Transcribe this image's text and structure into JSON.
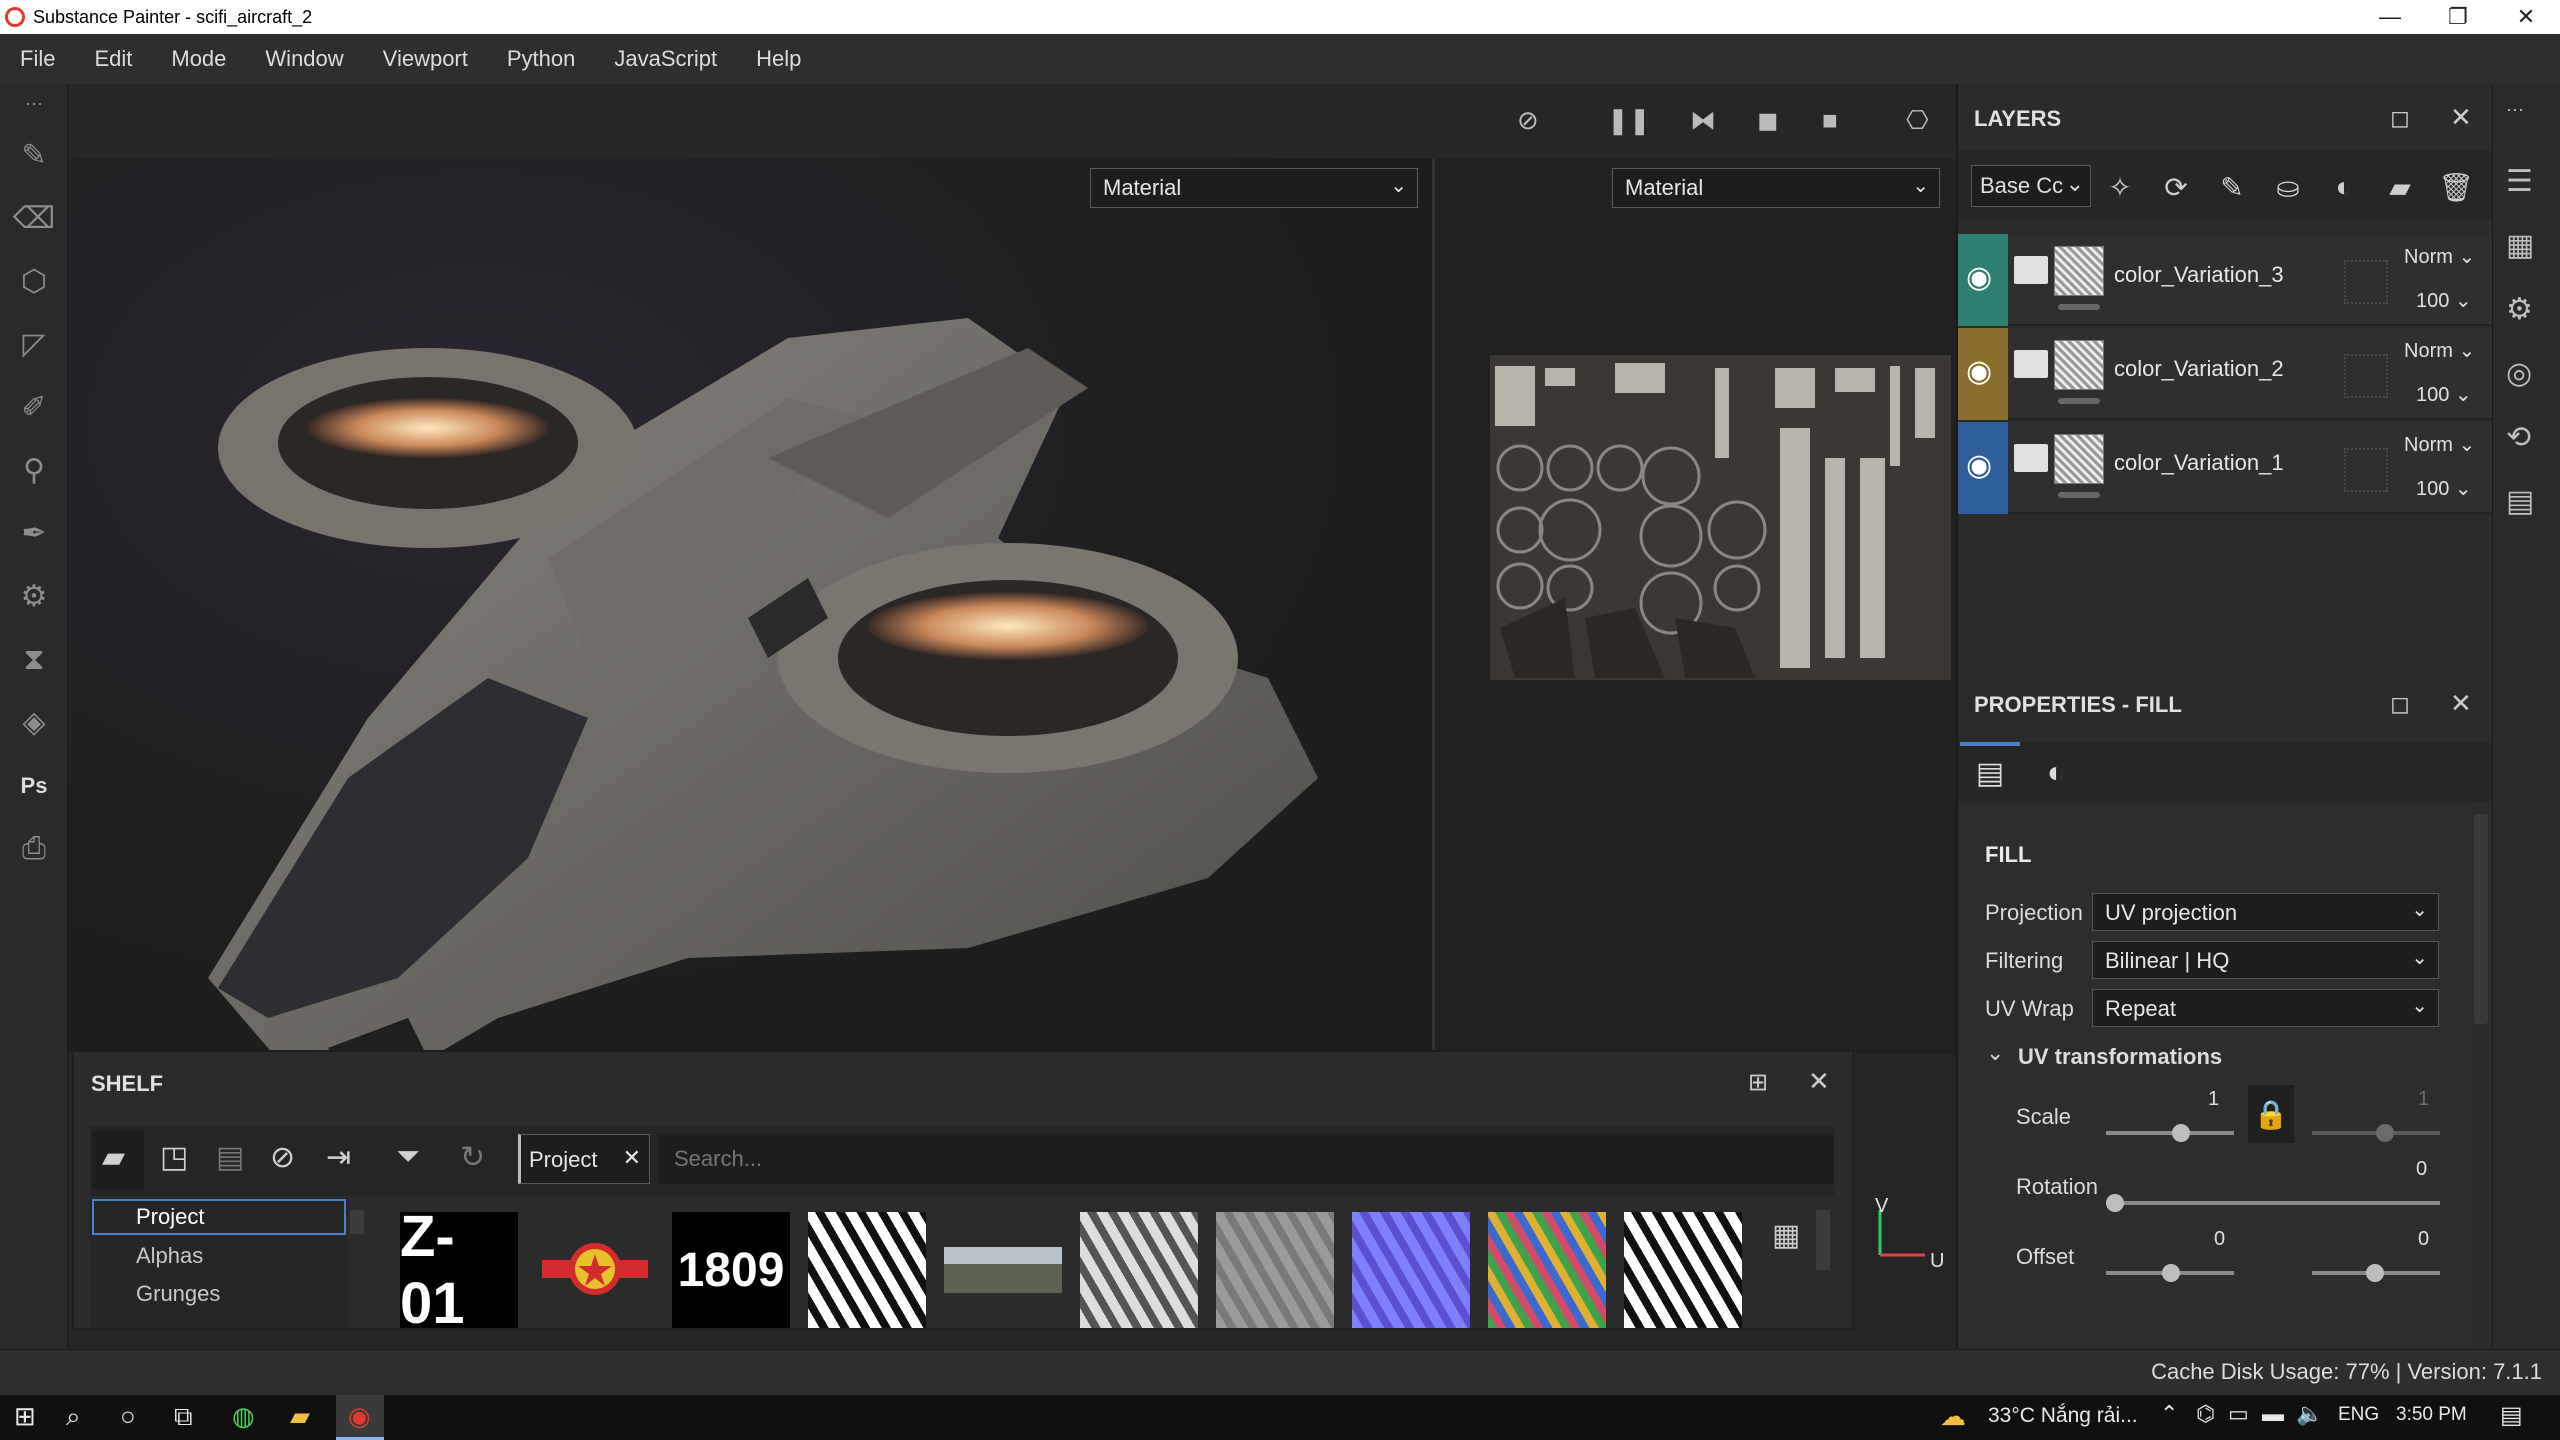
{
  "window": {
    "title": "Substance Painter - scifi_aircraft_2",
    "minimize": "—",
    "restore": "❐",
    "close": "✕"
  },
  "menu": [
    "File",
    "Edit",
    "Mode",
    "Window",
    "Viewport",
    "Python",
    "JavaScript",
    "Help"
  ],
  "viewport": {
    "left_material": "Material",
    "right_material": "Material",
    "axis_v": "V",
    "axis_u": "U"
  },
  "layers": {
    "title": "LAYERS",
    "channel": "Base Cc",
    "items": [
      {
        "name": "color_Variation_3",
        "blend": "Norm",
        "opacity": "100",
        "color": "#2f7f72"
      },
      {
        "name": "color_Variation_2",
        "blend": "Norm",
        "opacity": "100",
        "color": "#8a6f2f"
      },
      {
        "name": "color_Variation_1",
        "blend": "Norm",
        "opacity": "100",
        "color": "#2f5f9a"
      }
    ]
  },
  "properties": {
    "title": "PROPERTIES - FILL",
    "section": "FILL",
    "projection_label": "Projection",
    "projection_value": "UV projection",
    "filtering_label": "Filtering",
    "filtering_value": "Bilinear | HQ",
    "uvwrap_label": "UV Wrap",
    "uvwrap_value": "Repeat",
    "uvtrans_label": "UV transformations",
    "scale_label": "Scale",
    "scale_value": "1",
    "scale_value2": "1",
    "rotation_label": "Rotation",
    "rotation_value": "0",
    "offset_label": "Offset",
    "offset_value_u": "0",
    "offset_value_v": "0"
  },
  "shelf": {
    "title": "SHELF",
    "tag": "Project",
    "search_placeholder": "Search...",
    "tree": [
      "Project",
      "Alphas",
      "Grunges"
    ],
    "thumb_labels": [
      "Z-01",
      "1809"
    ]
  },
  "status": {
    "text": "Cache Disk Usage: 77% | Version: 7.1.1"
  },
  "taskbar": {
    "weather": "33°C  Nắng rải...",
    "lang": "ENG",
    "time": "3:50 PM"
  }
}
